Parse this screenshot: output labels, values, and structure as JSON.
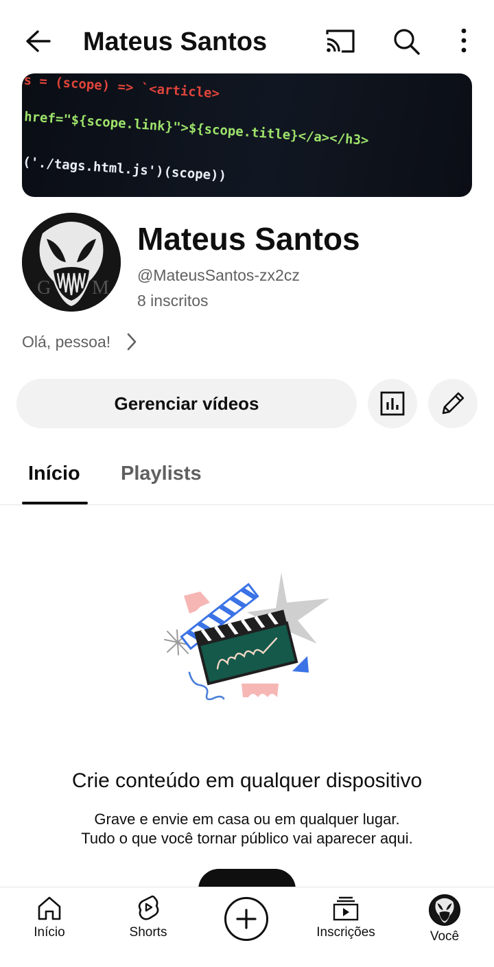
{
  "topbar": {
    "title": "Mateus Santos",
    "icons": [
      "back-arrow-icon",
      "cast-icon",
      "search-icon",
      "more-vertical-icon"
    ]
  },
  "banner": {
    "code_lines": [
      "ts = (scope) => `<article>",
      "href=\"${scope.link}\">${scope.title}</a></h3>",
      "('./tags.html.js')(scope))"
    ]
  },
  "channel": {
    "name": "Mateus Santos",
    "handle": "@MateusSantos-zx2cz",
    "subscribers": "8 inscritos",
    "description": "Olá, pessoa!",
    "avatar_letters": [
      "G",
      "M"
    ]
  },
  "actions": {
    "manage_label": "Gerenciar vídeos",
    "icons": [
      "analytics-icon",
      "edit-pencil-icon"
    ]
  },
  "tabs": [
    {
      "label": "Início",
      "active": true
    },
    {
      "label": "Playlists",
      "active": false
    }
  ],
  "empty_state": {
    "title": "Crie conteúdo em qualquer dispositivo",
    "line1": "Grave e envie em casa ou em qualquer lugar.",
    "line2": "Tudo o que você tornar público vai aparecer aqui."
  },
  "bottom_nav": [
    {
      "label": "Início",
      "icon": "home-icon"
    },
    {
      "label": "Shorts",
      "icon": "shorts-icon"
    },
    {
      "label": "",
      "icon": "create-plus-icon"
    },
    {
      "label": "Inscrições",
      "icon": "subscriptions-icon"
    },
    {
      "label": "Você",
      "icon": "avatar"
    }
  ],
  "colors": {
    "text_primary": "#0f0f0f",
    "text_secondary": "#606060",
    "button_bg": "#f2f2f2",
    "divider": "#e5e5e5"
  }
}
